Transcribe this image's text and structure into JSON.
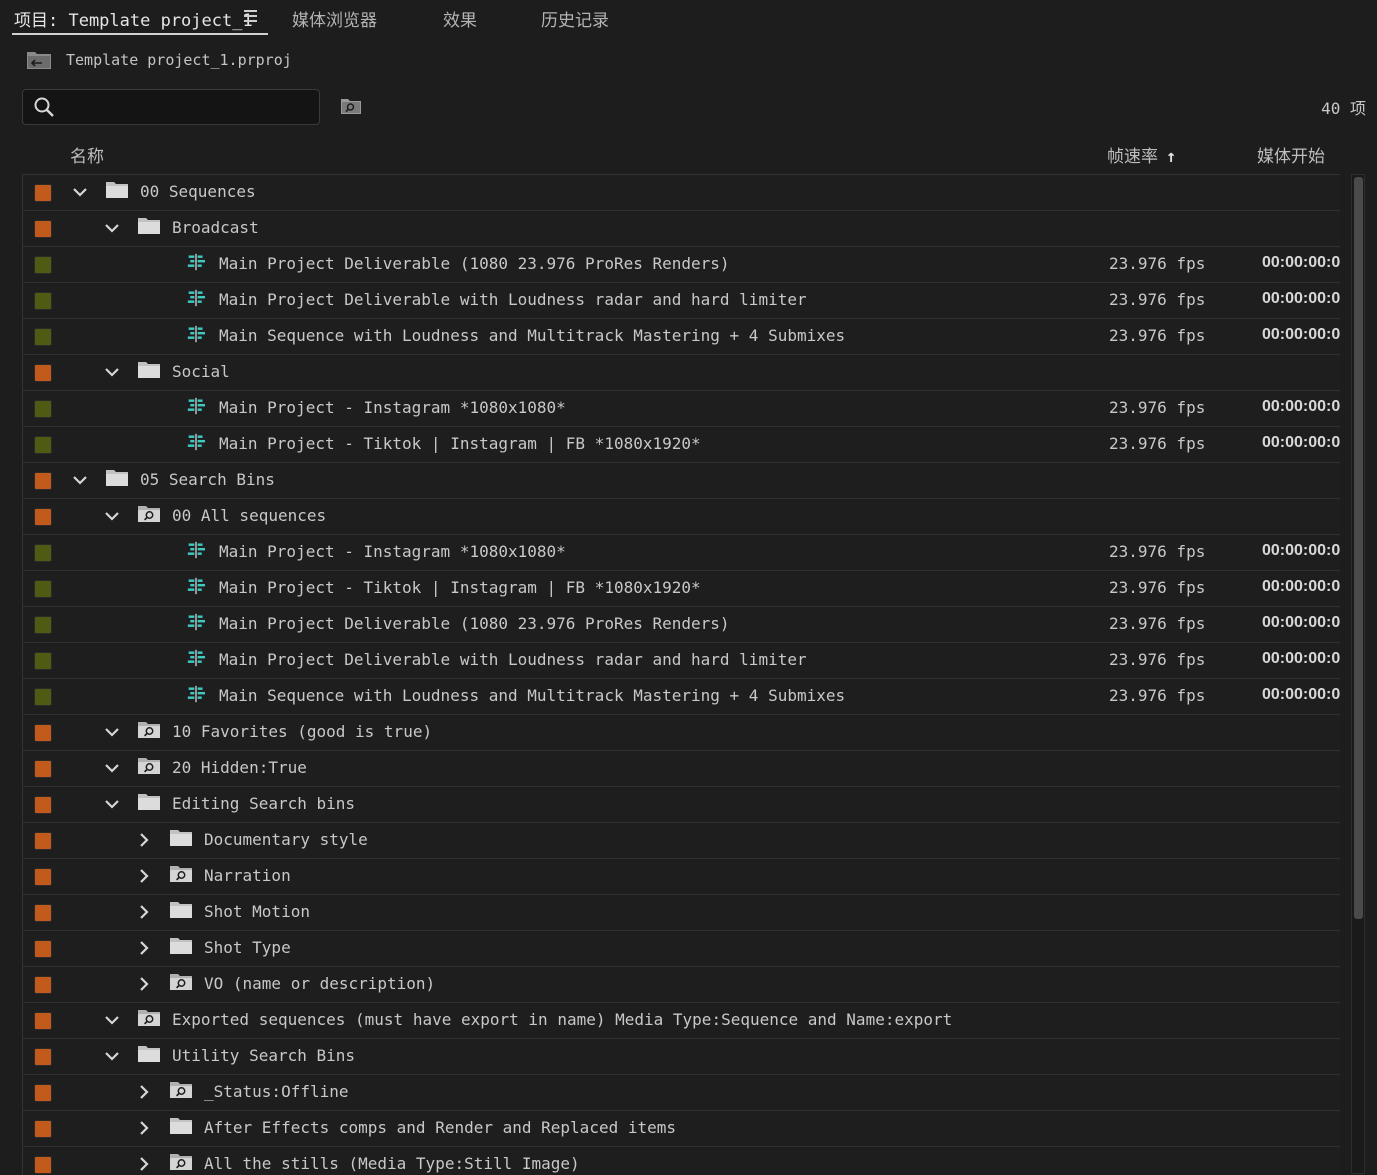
{
  "tabs": [
    {
      "label": "项目: Template project_1"
    },
    {
      "label": "媒体浏览器"
    },
    {
      "label": "效果"
    },
    {
      "label": "历史记录"
    }
  ],
  "path": {
    "filename": "Template project_1.prproj"
  },
  "search": {
    "value": "",
    "placeholder": ""
  },
  "item_count": "40 项",
  "columns": {
    "name": "名称",
    "framerate": "帧速率",
    "media_start": "媒体开始",
    "sort_arrow": "↑"
  },
  "colors": {
    "chip_bin": "#c25a1c",
    "chip_sequence": "#4f5a13",
    "sequence_icon": "#3ec9c3"
  },
  "rows": [
    {
      "level": 0,
      "type": "folder",
      "expanded": true,
      "label": "00 Sequences",
      "chip": "bin"
    },
    {
      "level": 1,
      "type": "folder",
      "expanded": true,
      "label": "Broadcast",
      "chip": "bin"
    },
    {
      "level": 2,
      "type": "sequence",
      "label": "Main Project Deliverable (1080 23.976 ProRes Renders)",
      "chip": "seq",
      "fps": "23.976 fps",
      "start": "00:00:00:0"
    },
    {
      "level": 2,
      "type": "sequence",
      "label": "Main Project Deliverable with Loudness radar and hard limiter",
      "chip": "seq",
      "fps": "23.976 fps",
      "start": "00:00:00:0"
    },
    {
      "level": 2,
      "type": "sequence",
      "label": "Main Sequence with Loudness and Multitrack Mastering + 4 Submixes",
      "chip": "seq",
      "fps": "23.976 fps",
      "start": "00:00:00:0"
    },
    {
      "level": 1,
      "type": "folder",
      "expanded": true,
      "label": "Social",
      "chip": "bin"
    },
    {
      "level": 2,
      "type": "sequence",
      "label": "Main Project - Instagram *1080x1080*",
      "chip": "seq",
      "fps": "23.976 fps",
      "start": "00:00:00:0"
    },
    {
      "level": 2,
      "type": "sequence",
      "label": "Main Project - Tiktok |  Instagram | FB  *1080x1920*",
      "chip": "seq",
      "fps": "23.976 fps",
      "start": "00:00:00:0"
    },
    {
      "level": 0,
      "type": "folder",
      "expanded": true,
      "label": "05 Search Bins",
      "chip": "bin"
    },
    {
      "level": 1,
      "type": "search",
      "expanded": true,
      "label": "00 All sequences",
      "chip": "bin"
    },
    {
      "level": 2,
      "type": "sequence",
      "label": "Main Project - Instagram *1080x1080*",
      "chip": "seq",
      "fps": "23.976 fps",
      "start": "00:00:00:0"
    },
    {
      "level": 2,
      "type": "sequence",
      "label": "Main Project - Tiktok |  Instagram | FB  *1080x1920*",
      "chip": "seq",
      "fps": "23.976 fps",
      "start": "00:00:00:0"
    },
    {
      "level": 2,
      "type": "sequence",
      "label": "Main Project Deliverable (1080 23.976 ProRes Renders)",
      "chip": "seq",
      "fps": "23.976 fps",
      "start": "00:00:00:0"
    },
    {
      "level": 2,
      "type": "sequence",
      "label": "Main Project Deliverable with Loudness radar and hard limiter",
      "chip": "seq",
      "fps": "23.976 fps",
      "start": "00:00:00:0"
    },
    {
      "level": 2,
      "type": "sequence",
      "label": "Main Sequence with Loudness and Multitrack Mastering + 4 Submixes",
      "chip": "seq",
      "fps": "23.976 fps",
      "start": "00:00:00:0"
    },
    {
      "level": 1,
      "type": "search",
      "expanded": true,
      "label": "10 Favorites (good is true)",
      "chip": "bin"
    },
    {
      "level": 1,
      "type": "search",
      "expanded": true,
      "label": "20 Hidden:True",
      "chip": "bin"
    },
    {
      "level": 1,
      "type": "folder",
      "expanded": true,
      "label": "Editing Search bins",
      "chip": "bin"
    },
    {
      "level": 2,
      "type": "folder",
      "expanded": false,
      "label": "Documentary style",
      "chip": "bin"
    },
    {
      "level": 2,
      "type": "search",
      "expanded": false,
      "label": "Narration",
      "chip": "bin"
    },
    {
      "level": 2,
      "type": "folder",
      "expanded": false,
      "label": "Shot Motion",
      "chip": "bin"
    },
    {
      "level": 2,
      "type": "folder",
      "expanded": false,
      "label": "Shot Type",
      "chip": "bin"
    },
    {
      "level": 2,
      "type": "search",
      "expanded": false,
      "label": "VO (name or description)",
      "chip": "bin"
    },
    {
      "level": 1,
      "type": "search",
      "expanded": true,
      "label": "Exported sequences (must have export in name) Media Type:Sequence and Name:export",
      "chip": "bin"
    },
    {
      "level": 1,
      "type": "folder",
      "expanded": true,
      "label": "Utility Search Bins",
      "chip": "bin"
    },
    {
      "level": 2,
      "type": "search",
      "expanded": false,
      "label": "_Status:Offline",
      "chip": "bin"
    },
    {
      "level": 2,
      "type": "folder",
      "expanded": false,
      "label": "After Effects comps and Render and Replaced items",
      "chip": "bin"
    },
    {
      "level": 2,
      "type": "search",
      "expanded": false,
      "label": "All the stills (Media Type:Still Image)",
      "chip": "bin"
    }
  ]
}
